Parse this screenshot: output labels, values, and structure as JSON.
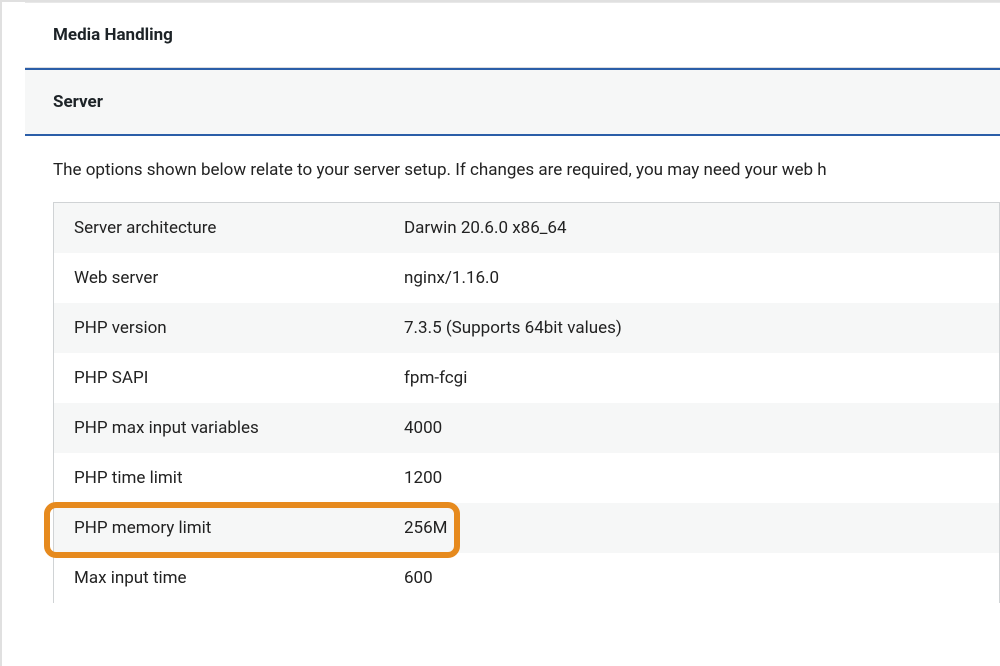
{
  "sections": {
    "media_handling": "Media Handling",
    "server": "Server"
  },
  "description": "The options shown below relate to your server setup. If changes are required, you may need your web h",
  "rows": [
    {
      "label": "Server architecture",
      "value": "Darwin 20.6.0 x86_64"
    },
    {
      "label": "Web server",
      "value": "nginx/1.16.0"
    },
    {
      "label": "PHP version",
      "value": "7.3.5 (Supports 64bit values)"
    },
    {
      "label": "PHP SAPI",
      "value": "fpm-fcgi"
    },
    {
      "label": "PHP max input variables",
      "value": "4000"
    },
    {
      "label": "PHP time limit",
      "value": "1200"
    },
    {
      "label": "PHP memory limit",
      "value": "256M"
    },
    {
      "label": "Max input time",
      "value": "600"
    }
  ]
}
